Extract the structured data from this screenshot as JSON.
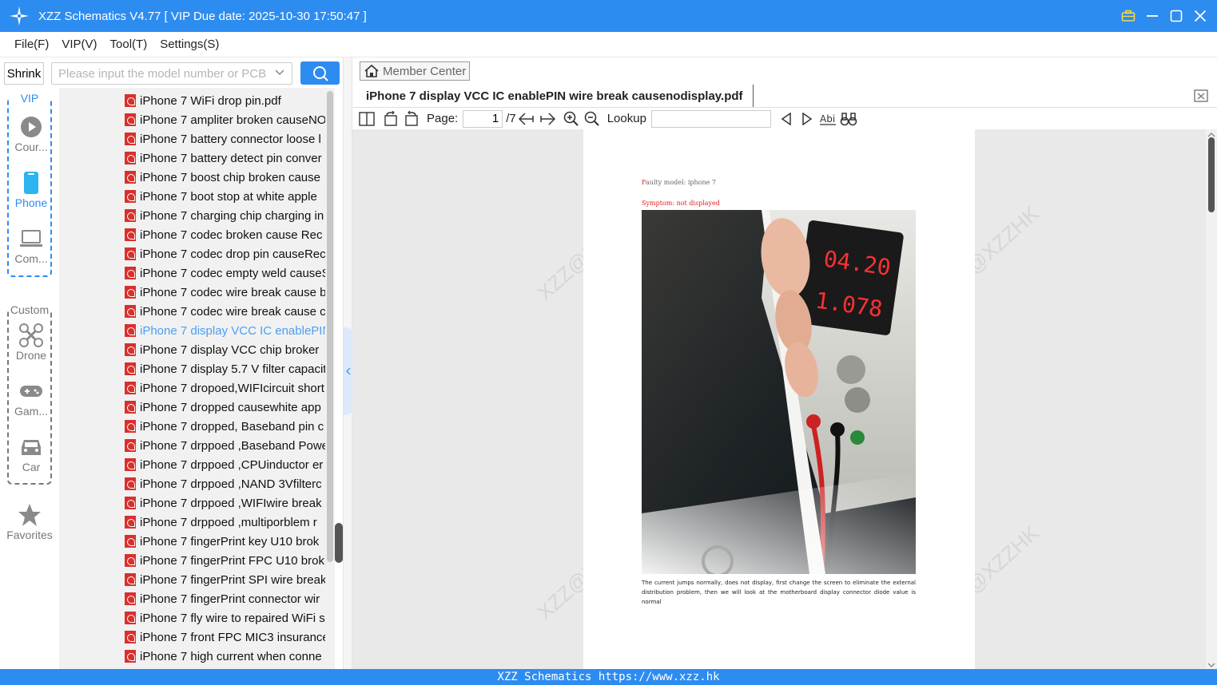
{
  "window": {
    "title": "XZZ Schematics V4.77 [ VIP Due date: 2025-10-30 17:50:47 ]"
  },
  "menu": [
    "File(F)",
    "VIP(V)",
    "Tool(T)",
    "Settings(S)"
  ],
  "toolbar": {
    "shrink_label": "Shrink",
    "search_placeholder": "Please input the model number or PCB"
  },
  "categories": {
    "vip_label": "VIP",
    "vip_items": [
      "Cour...",
      "Phone",
      "Com..."
    ],
    "custom_label": "Custom",
    "custom_items": [
      "Drone",
      "Gam...",
      "Car"
    ],
    "favorites_label": "Favorites",
    "active": "Phone"
  },
  "files": [
    "iPhone 7 WiFi drop pin.pdf",
    "iPhone 7 ampliter broken causeNO",
    "iPhone 7 battery connector loose l",
    "iPhone 7 battery detect pin conver",
    "iPhone 7 boost chip  broken cause",
    "iPhone 7 boot stop at white apple",
    "iPhone 7 charging chip charging in",
    "iPhone 7 codec  broken cause Rec",
    "iPhone 7 codec drop pin causeRec",
    "iPhone 7 codec empty weld causeS",
    "iPhone 7 codec wire break cause b",
    "iPhone 7 codec wire break cause c",
    "iPhone 7 display  VCC IC enablePIN",
    "iPhone 7 display  VCC chip  broker",
    "iPhone 7 display 5.7 V filter capacit",
    "iPhone 7 dropoed,WIFIcircuit short",
    "iPhone 7 dropped causewhite app",
    "iPhone 7 dropped, Baseband pin c",
    "iPhone 7 drppoed ,Baseband Powe",
    "iPhone 7 drppoed ,CPUinductor er",
    "iPhone 7 drppoed ,NAND 3Vfilterc",
    "iPhone 7 drppoed ,WIFIwire break",
    "iPhone 7 drppoed ,multiporblem r",
    "iPhone 7 fingerPrint  key U10 brok",
    "iPhone 7 fingerPrint FPC U10 brok",
    "iPhone 7 fingerPrint SPI wire break",
    "iPhone 7 fingerPrint connector wir",
    "iPhone 7 fly wire to repaired WiFi s",
    "iPhone 7 front FPC MIC3 insurance",
    "iPhone 7 high current when conne"
  ],
  "active_file_index": 12,
  "member_center_label": "Member Center",
  "document": {
    "tab_title": "iPhone 7 display  VCC IC enablePIN wire break causenodisplay.pdf",
    "page_label": "Page:",
    "current_page": "1",
    "total_pages": "/7",
    "lookup_label": "Lookup",
    "lookup_value": "",
    "page_content": {
      "faulty_model": "Faulty model: iphone 7",
      "symptom": "Symptom: not displayed",
      "meter_top": "04.20",
      "meter_bottom": "1.078",
      "description": "The current jumps normally, does not display, first change the screen to eliminate the external distribution problem, then we will look at the motherboard display connector diode value is normal",
      "watermark": "XZZ@XZZHK"
    }
  },
  "footer": "XZZ Schematics https://www.xzz.hk",
  "colors": {
    "accent": "#2d8cf0",
    "active_file": "#4a9ff5",
    "pdf_icon": "#d9302c",
    "symptom_red": "#e02020"
  }
}
